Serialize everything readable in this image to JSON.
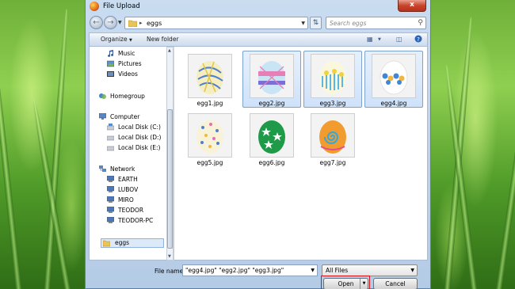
{
  "window": {
    "title": "File Upload",
    "close_label": "x"
  },
  "nav": {
    "back_icon": "back-arrow-icon",
    "forward_icon": "forward-arrow-icon",
    "address_path": "eggs",
    "search_placeholder": "Search eggs"
  },
  "toolbar": {
    "organize_label": "Organize",
    "new_folder_label": "New folder"
  },
  "sidebar": {
    "items": [
      {
        "label": "Music",
        "icon": "music-icon"
      },
      {
        "label": "Pictures",
        "icon": "pictures-icon"
      },
      {
        "label": "Videos",
        "icon": "videos-icon"
      },
      {
        "label": "Homegroup",
        "icon": "homegroup-icon"
      },
      {
        "label": "Computer",
        "icon": "computer-icon"
      },
      {
        "label": "Local Disk (C:)",
        "icon": "drive-icon"
      },
      {
        "label": "Local Disk (D:)",
        "icon": "drive-icon"
      },
      {
        "label": "Local Disk (E:)",
        "icon": "drive-icon"
      },
      {
        "label": "Network",
        "icon": "network-icon"
      },
      {
        "label": "EARTH",
        "icon": "pc-icon"
      },
      {
        "label": "LUBOV",
        "icon": "pc-icon"
      },
      {
        "label": "MIRO",
        "icon": "pc-icon"
      },
      {
        "label": "TEODOR",
        "icon": "pc-icon"
      },
      {
        "label": "TEODOR-PC",
        "icon": "pc-icon"
      },
      {
        "label": "eggs",
        "icon": "folder-icon",
        "selected": true
      }
    ]
  },
  "files": [
    {
      "name": "egg1.jpg",
      "selected": false
    },
    {
      "name": "egg2.jpg",
      "selected": true
    },
    {
      "name": "egg3.jpg",
      "selected": true
    },
    {
      "name": "egg4.jpg",
      "selected": true
    },
    {
      "name": "egg5.jpg",
      "selected": false
    },
    {
      "name": "egg6.jpg",
      "selected": false
    },
    {
      "name": "egg7.jpg",
      "selected": false
    }
  ],
  "bottom": {
    "filename_label": "File name:",
    "filename_value": "\"egg4.jpg\" \"egg2.jpg\" \"egg3.jpg\"",
    "filter_value": "All Files",
    "open_label": "Open",
    "cancel_label": "Cancel"
  },
  "colors": {
    "selection_border": "#7da2ce",
    "highlight": "#d4161c",
    "titlebar": "#c9dcf0"
  }
}
